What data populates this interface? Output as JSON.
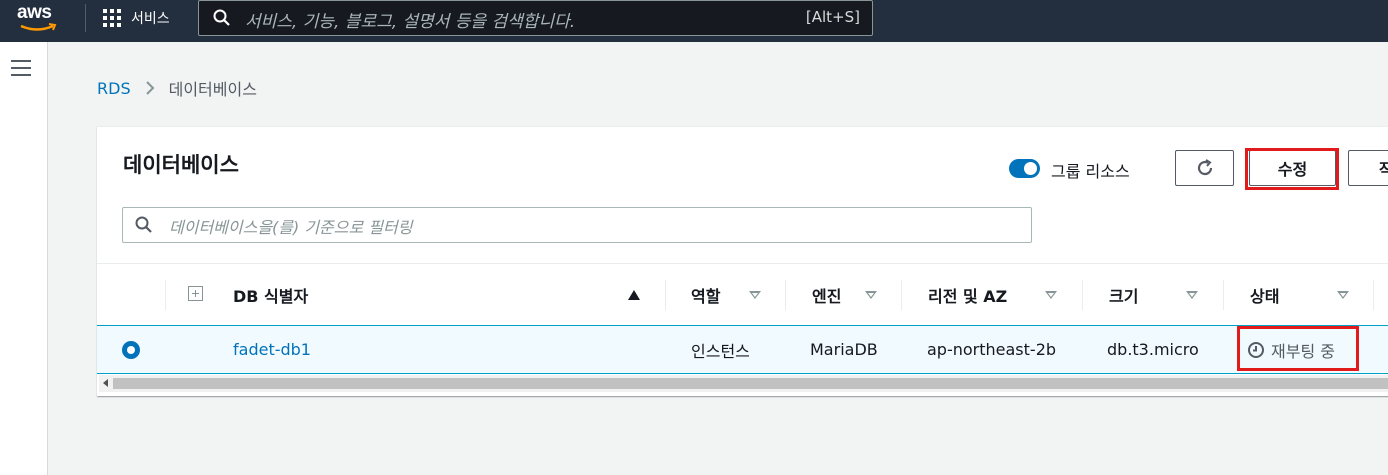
{
  "topnav": {
    "logo_text": "aws",
    "services_label": "서비스",
    "search_placeholder": "서비스, 기능, 블로그, 설명서 등을 검색합니다.",
    "search_shortcut": "[Alt+S]"
  },
  "breadcrumb": {
    "root": "RDS",
    "current": "데이터베이스"
  },
  "panel": {
    "title": "데이터베이스",
    "group_toggle_label": "그룹 리소스",
    "group_toggle_on": true,
    "refresh_icon": "refresh-icon",
    "modify_button": "수정",
    "next_button_partial": "작",
    "filter_placeholder": "데이터베이스을(를) 기준으로 필터링"
  },
  "table": {
    "columns": [
      {
        "label": "DB 식별자",
        "sort": "ascending"
      },
      {
        "label": "역할",
        "sort": "none"
      },
      {
        "label": "엔진",
        "sort": "none"
      },
      {
        "label": "리전 및 AZ",
        "sort": "none"
      },
      {
        "label": "크기",
        "sort": "none"
      },
      {
        "label": "상태",
        "sort": "none"
      }
    ],
    "rows": [
      {
        "selected": true,
        "identifier": "fadet-db1",
        "role": "인스턴스",
        "engine": "MariaDB",
        "region_az": "ap-northeast-2b",
        "size": "db.t3.micro",
        "status": "재부팅 중",
        "status_icon": "clock-icon"
      }
    ]
  },
  "colors": {
    "nav_bg": "#232f3e",
    "accent": "#0073bb",
    "highlight": "#e11b1b",
    "selected_row": "#f1faff"
  }
}
